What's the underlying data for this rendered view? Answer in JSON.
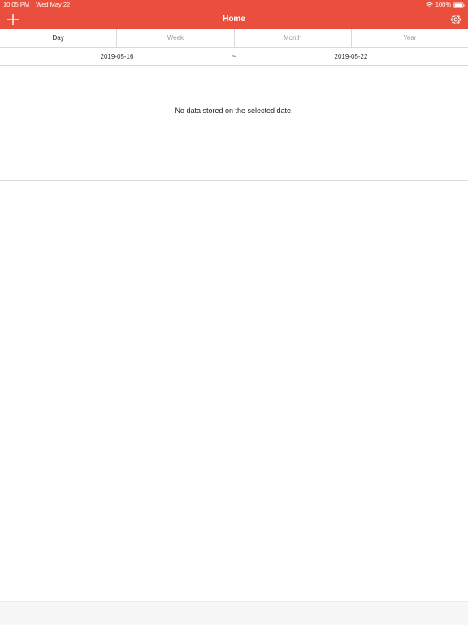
{
  "status_bar": {
    "time": "10:05 PM",
    "date": "Wed May 22",
    "battery": "100%",
    "icons": [
      "wifi-icon",
      "battery-icon"
    ]
  },
  "nav": {
    "title": "Home",
    "left_icon": "plus-icon",
    "right_icon": "gear-icon"
  },
  "tabs": [
    {
      "label": "Day",
      "active": true
    },
    {
      "label": "Week",
      "active": false
    },
    {
      "label": "Month",
      "active": false
    },
    {
      "label": "Year",
      "active": false
    }
  ],
  "date_range": {
    "start": "2019-05-16",
    "separator": "~",
    "end": "2019-05-22"
  },
  "empty_message": "No data stored on the selected date.",
  "colors": {
    "header_bg": "#ea4e3d",
    "header_text": "#ffffff",
    "divider": "#d9d9d9",
    "inactive_tab": "#9a9a9a"
  }
}
